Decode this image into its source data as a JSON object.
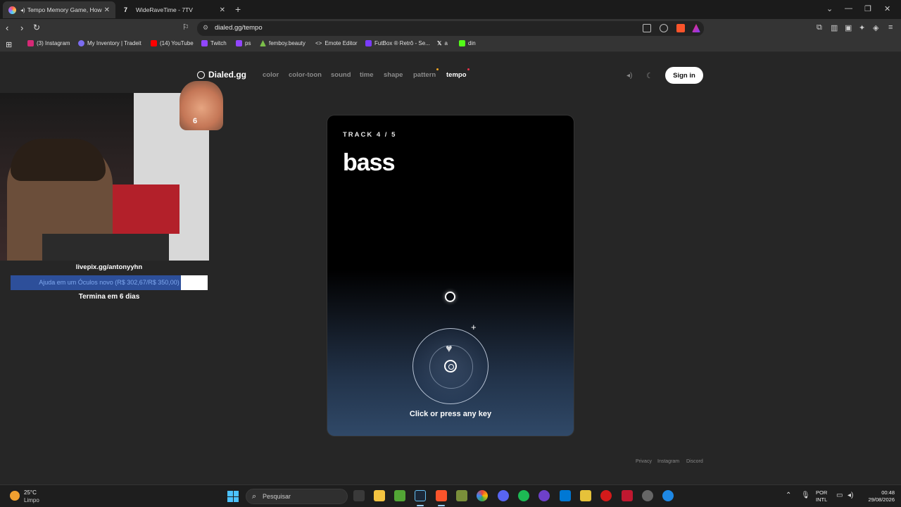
{
  "browser": {
    "tabs": [
      {
        "title": "Tempo Memory Game, How",
        "active": true
      },
      {
        "title": "WideRaveTime - 7TV",
        "active": false
      }
    ],
    "url": "dialed.gg/tempo",
    "bookmarks": [
      {
        "label": "(3) Instagram",
        "icon": "instagram-icon",
        "color": "#d62976"
      },
      {
        "label": "My Inventory | Tradeit",
        "icon": "tradeit-icon",
        "color": "#7b6cf0"
      },
      {
        "label": "(14) YouTube",
        "icon": "youtube-icon",
        "color": "#ff0000"
      },
      {
        "label": "Twitch",
        "icon": "twitch-icon",
        "color": "#9146ff"
      },
      {
        "label": "ps",
        "icon": "twitch-icon",
        "color": "#9146ff"
      },
      {
        "label": "femboy.beauty",
        "icon": "tree-icon",
        "color": "#7bbf4a"
      },
      {
        "label": "Emote Editor",
        "icon": "code-icon",
        "color": "#cccccc"
      },
      {
        "label": "FutBox ® Retrô - Se...",
        "icon": "futbox-icon",
        "color": "#7a3cff"
      },
      {
        "label": "a",
        "icon": "x-icon",
        "color": "#ffffff"
      },
      {
        "label": "din",
        "icon": "kick-icon",
        "color": "#53fc18"
      }
    ]
  },
  "site": {
    "logo": "Dialed.gg",
    "nav": [
      {
        "label": "color",
        "active": false,
        "dot": null
      },
      {
        "label": "color-toon",
        "active": false,
        "dot": null
      },
      {
        "label": "sound",
        "active": false,
        "dot": null
      },
      {
        "label": "time",
        "active": false,
        "dot": null
      },
      {
        "label": "shape",
        "active": false,
        "dot": null
      },
      {
        "label": "pattern",
        "active": false,
        "dot": "#f5a623"
      },
      {
        "label": "tempo",
        "active": true,
        "dot": "#e8334a"
      }
    ],
    "signin": "Sign in",
    "footer": [
      "Privacy",
      "Instagram",
      "Discord"
    ]
  },
  "overlay": {
    "donation_url": "livepix.gg/antonyyhn",
    "goal_text": "Ajuda em um Óculos novo (R$ 302,67/R$ 350,00)",
    "goal_progress": 0.865,
    "ends_text": "Termina em 6 dias",
    "cat_number": "6"
  },
  "game": {
    "track_label": "TRACK 4 / 5",
    "track_name": "bass",
    "prompt": "Click or press any key"
  },
  "taskbar": {
    "temp": "25°C",
    "condition": "Limpo",
    "search": "Pesquisar",
    "lang_top": "POR",
    "lang_bottom": "INTL",
    "time": "00:48",
    "date": "29/08/2026"
  }
}
